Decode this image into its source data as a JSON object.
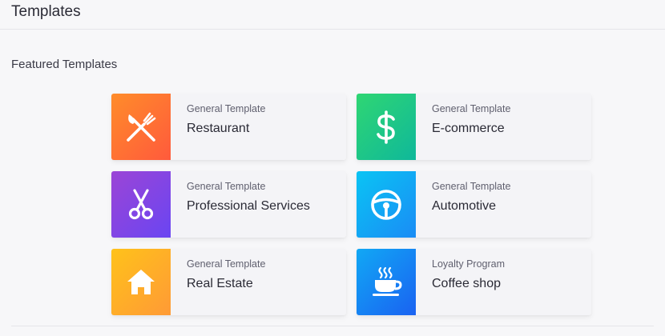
{
  "header": {
    "title": "Templates"
  },
  "featured": {
    "title": "Featured Templates",
    "cards": [
      {
        "category": "General Template",
        "name": "Restaurant",
        "icon": "fork-knife-icon",
        "gradient": [
          "#ff8c2a",
          "#ff5a3c"
        ]
      },
      {
        "category": "General Template",
        "name": "E-commerce",
        "icon": "dollar-icon",
        "gradient": [
          "#2fd673",
          "#0fb89a"
        ]
      },
      {
        "category": "General Template",
        "name": "Professional Services",
        "icon": "scissors-icon",
        "gradient": [
          "#9b45d6",
          "#6a45f2"
        ]
      },
      {
        "category": "General Template",
        "name": "Automotive",
        "icon": "steering-wheel-icon",
        "gradient": [
          "#0ac4f4",
          "#1a8cf5"
        ]
      },
      {
        "category": "General Template",
        "name": "Real Estate",
        "icon": "house-icon",
        "gradient": [
          "#ffc21a",
          "#ff9a36"
        ]
      },
      {
        "category": "Loyalty Program",
        "name": "Coffee shop",
        "icon": "coffee-cup-icon",
        "gradient": [
          "#11a8f4",
          "#1a62f2"
        ]
      }
    ]
  }
}
